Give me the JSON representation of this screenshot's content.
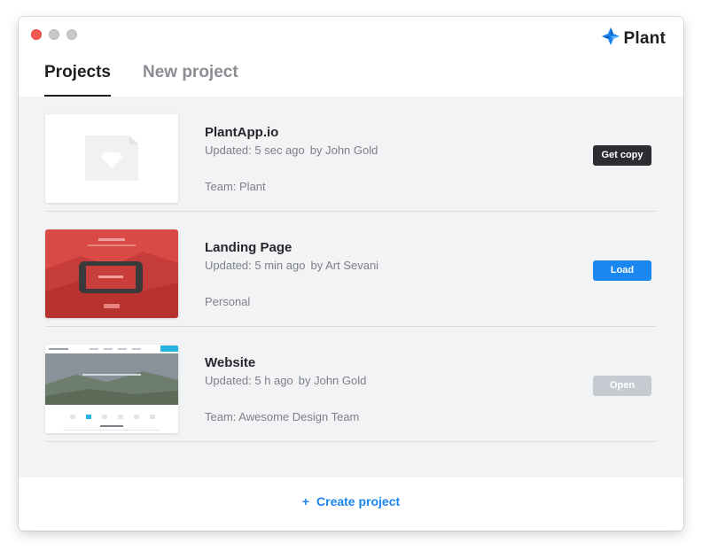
{
  "brand": {
    "name": "Plant",
    "icon": "plant-logo-icon",
    "accent": "#1a86f0"
  },
  "tabs": [
    {
      "label": "Projects",
      "active": true
    },
    {
      "label": "New project",
      "active": false
    }
  ],
  "projects": [
    {
      "name": "PlantApp.io",
      "updated": "Updated: 5 sec ago",
      "author": "by John Gold",
      "team": "Team: Plant",
      "action": "Get copy",
      "action_style": "dark"
    },
    {
      "name": "Landing Page",
      "updated": "Updated: 5 min ago",
      "author": "by Art Sevani",
      "team": "Personal",
      "action": "Load",
      "action_style": "blue"
    },
    {
      "name": "Website",
      "updated": "Updated: 5 h ago",
      "author": "by John Gold",
      "team": "Team: Awesome Design Team",
      "action": "Open",
      "action_style": "disabled"
    }
  ],
  "footer": {
    "create_icon": "+",
    "create_label": "Create project"
  }
}
